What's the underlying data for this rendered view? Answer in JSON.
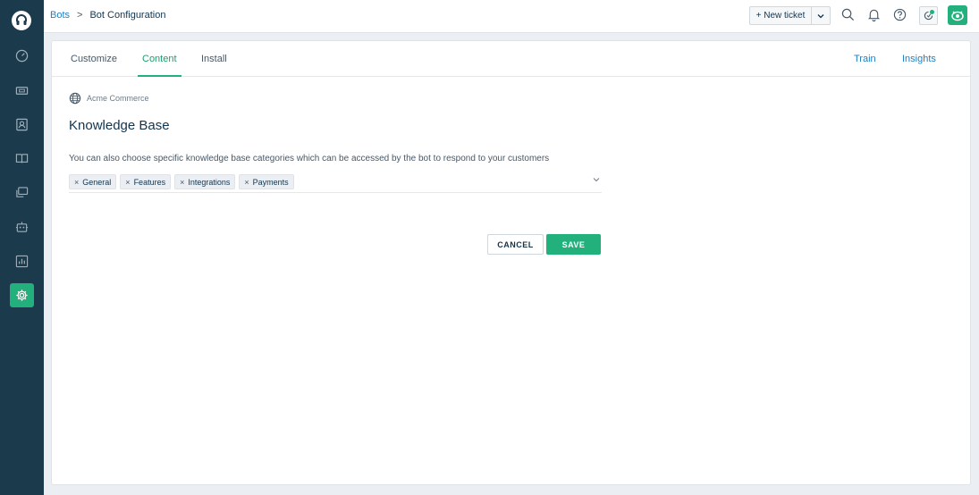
{
  "breadcrumb": {
    "parent": "Bots",
    "separator": ">",
    "current": "Bot Configuration"
  },
  "topbar": {
    "new_ticket_label": "+ New ticket",
    "icons": [
      "search-icon",
      "bell-icon",
      "help-icon",
      "apps-icon",
      "avatar"
    ]
  },
  "tabs": {
    "left": [
      "Customize",
      "Content",
      "Install"
    ],
    "right": [
      "Train",
      "Insights"
    ],
    "active": "Content"
  },
  "content": {
    "bot_name": "Acme Commerce",
    "heading": "Knowledge Base",
    "description": "You can also choose specific knowledge base categories which can be accessed by the bot to respond to your customers",
    "chips": [
      "General",
      "Features",
      "Integrations",
      "Payments"
    ],
    "chip_remove_glyph": "×"
  },
  "actions": {
    "cancel": "CANCEL",
    "save": "SAVE"
  },
  "colors": {
    "rail": "#1b3a4b",
    "accent": "#22b07d",
    "link": "#1f7fc2"
  }
}
